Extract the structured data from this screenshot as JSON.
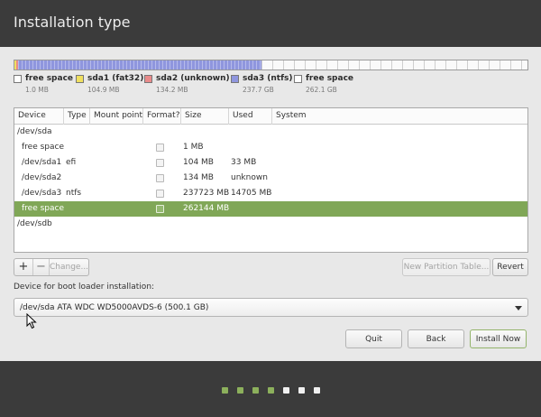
{
  "window": {
    "title": "Installation type"
  },
  "partition_bar": [
    {
      "name": "free space",
      "fraction": 0.0,
      "color": "#ffffff"
    },
    {
      "name": "sda1 (fat32)",
      "fraction": 0.0002,
      "color": "#f0e060"
    },
    {
      "name": "sda2 (unknown)",
      "fraction": 0.0003,
      "color": "#e98b8b"
    },
    {
      "name": "sda3 (ntfs)",
      "fraction": 0.475,
      "color": "#8f96de"
    },
    {
      "name": "free space",
      "fraction": 0.5245,
      "color": "#ffffff"
    }
  ],
  "legend": [
    {
      "name": "free space",
      "size": "1.0 MB",
      "color": "#ffffff"
    },
    {
      "name": "sda1 (fat32)",
      "size": "104.9 MB",
      "color": "#f0e060"
    },
    {
      "name": "sda2 (unknown)",
      "size": "134.2 MB",
      "color": "#e98b8b"
    },
    {
      "name": "sda3 (ntfs)",
      "size": "237.7 GB",
      "color": "#8f96de"
    },
    {
      "name": "free space",
      "size": "262.1 GB",
      "color": "#ffffff"
    }
  ],
  "table": {
    "columns": [
      "Device",
      "Type",
      "Mount point",
      "Format?",
      "Size",
      "Used",
      "System"
    ],
    "rows": [
      {
        "device": "/dev/sda",
        "type": "",
        "mount": "",
        "format": false,
        "size": "",
        "used": "",
        "system": "",
        "indent": false,
        "checkbox": false,
        "selected": false
      },
      {
        "device": "free space",
        "type": "",
        "mount": "",
        "format": false,
        "size": "1 MB",
        "used": "",
        "system": "",
        "indent": true,
        "checkbox": true,
        "selected": false
      },
      {
        "device": "/dev/sda1",
        "type": "efi",
        "mount": "",
        "format": false,
        "size": "104 MB",
        "used": "33 MB",
        "system": "",
        "indent": true,
        "checkbox": true,
        "selected": false
      },
      {
        "device": "/dev/sda2",
        "type": "",
        "mount": "",
        "format": false,
        "size": "134 MB",
        "used": "unknown",
        "system": "",
        "indent": true,
        "checkbox": true,
        "selected": false
      },
      {
        "device": "/dev/sda3",
        "type": "ntfs",
        "mount": "",
        "format": false,
        "size": "237723 MB",
        "used": "14705 MB",
        "system": "",
        "indent": true,
        "checkbox": true,
        "selected": false
      },
      {
        "device": "free space",
        "type": "",
        "mount": "",
        "format": false,
        "size": "262144 MB",
        "used": "",
        "system": "",
        "indent": true,
        "checkbox": true,
        "selected": true
      },
      {
        "device": "/dev/sdb",
        "type": "",
        "mount": "",
        "format": false,
        "size": "",
        "used": "",
        "system": "",
        "indent": false,
        "checkbox": false,
        "selected": false
      }
    ]
  },
  "toolbar": {
    "add_label": "+",
    "remove_label": "−",
    "change_label": "Change...",
    "new_table_label": "New Partition Table...",
    "revert_label": "Revert"
  },
  "bootloader": {
    "label": "Device for boot loader installation:",
    "selected": "/dev/sda   ATA WDC WD5000AVDS-6 (500.1 GB)"
  },
  "buttons": {
    "quit": "Quit",
    "back": "Back",
    "install": "Install Now"
  },
  "progress": {
    "total_steps": 7,
    "completed_steps": 4
  },
  "colors": {
    "accent": "#80a757",
    "titlebar": "#3b3b3b"
  }
}
